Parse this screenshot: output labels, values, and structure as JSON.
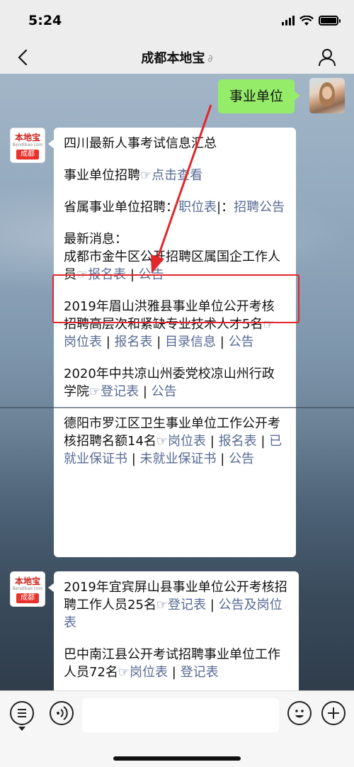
{
  "status": {
    "time": "5:24"
  },
  "nav": {
    "title": "成都本地宝"
  },
  "user_message": {
    "text": "事业单位"
  },
  "bot_avatar": {
    "brand_cn": "本地宝",
    "brand_en": "Bendibao.com",
    "city": "成都"
  },
  "card1": {
    "heading": "四川最新人事考试信息汇总",
    "shiye_label": "事业单位招聘",
    "point_icon": "☞",
    "click_view": "点击查看",
    "provincial_label": "省属事业单位招聘：",
    "job_table": "职位表",
    "sep_colon": "|：",
    "announcement": "招聘公告",
    "latest_label": "最新消息：",
    "item1_text": "成都市金牛区公开招聘区属国企工作人员",
    "item1_link1": "报名表",
    "item1_link2": "公告",
    "item2_text": "2019年眉山洪雅县事业单位公开考核招聘高层次和紧缺专业技术人才5名",
    "item2_link1": "岗位表",
    "item2_link2": "报名表",
    "item2_link3": "目录信息",
    "item2_link4": "公告",
    "item3_text": "2020年中共凉山州委党校凉山州行政学院",
    "item3_link1": "登记表",
    "item3_link2": "公告",
    "item4_text": "德阳市罗江区卫生事业单位工作公开考核招聘名额14名",
    "item4_link1": "岗位表",
    "item4_link2": "报名表",
    "item4_link3": "已就业保证书",
    "item4_link4": "未就业保证书",
    "item4_link5": "公告",
    "pipe": "|"
  },
  "card2": {
    "item1_text": "2019年宜宾屏山县事业单位公开考核招聘工作人员25名",
    "item1_link1": "登记表",
    "item1_link2": "公告及岗位表",
    "item2_text": "巴中南江县公开考试招聘事业单位工作人员72名",
    "item2_link1": "岗位表",
    "item2_link2": "登记表"
  },
  "colors": {
    "link": "#576b95",
    "bubble": "#95ec69",
    "highlight": "#e2262a"
  },
  "icons": [
    "back-arrow-icon",
    "profile-icon",
    "menu-icon",
    "voice-icon",
    "emoji-icon",
    "plus-icon"
  ]
}
